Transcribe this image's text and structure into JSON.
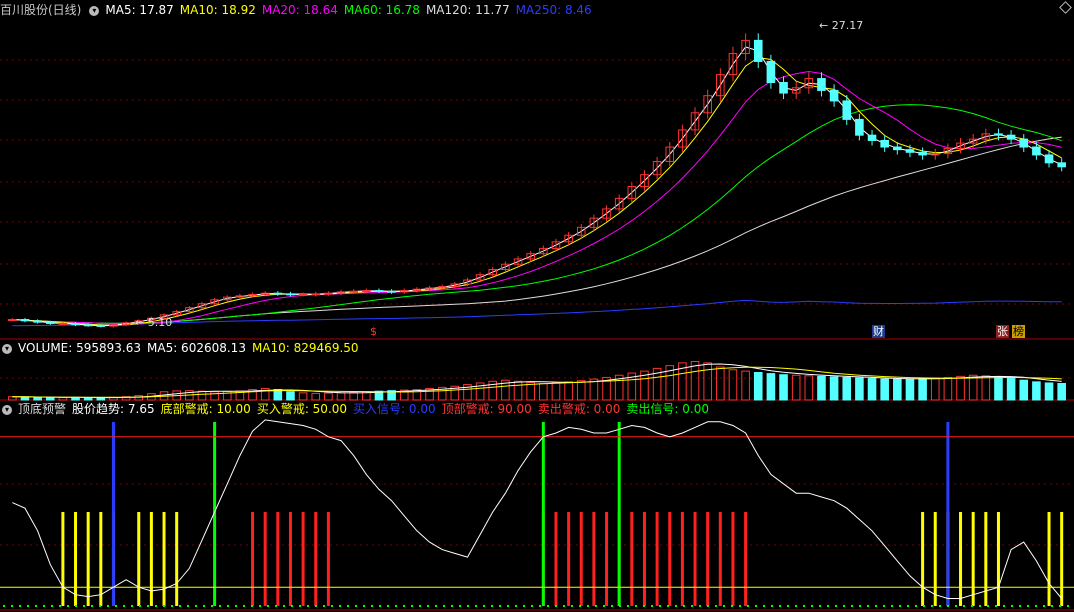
{
  "main_header": {
    "title": "百川股份(日线)",
    "ma5": "MA5: 17.87",
    "ma10": "MA10: 18.92",
    "ma20": "MA20: 18.64",
    "ma60": "MA60: 16.78",
    "ma120": "MA120: 11.77",
    "ma250": "MA250: 8.46"
  },
  "volume_header": {
    "volume": "VOLUME: 595893.63",
    "ma5": "MA5: 602608.13",
    "ma10": "MA10: 829469.50"
  },
  "indicator_header": {
    "name": "顶底预警",
    "trend": "股价趋势: 7.65",
    "bottom_warn": "底部警戒: 10.00",
    "buy_warn": "买入警戒: 50.00",
    "buy_signal": "买入信号: 0.00",
    "top_warn": "顶部警戒: 90.00",
    "sell_warn": "卖出警戒: 0.00",
    "sell_signal": "卖出信号: 0.00"
  },
  "annotations": {
    "high": "27.17",
    "low": "5.10",
    "marker_s": "$",
    "marker_cai": "财",
    "marker_zhang": "张",
    "marker_bang": "榜"
  },
  "colors": {
    "ma5": "#ffffff",
    "ma10": "#ffff00",
    "ma20": "#ff00ff",
    "ma60": "#00ff00",
    "ma120": "#dddddd",
    "ma250": "#2a3dff",
    "up": "#ff3232",
    "down": "#54ffff",
    "grid": "#7a0000"
  },
  "chart_data": {
    "type": "candlestick",
    "price_range": [
      4.5,
      28.5
    ],
    "closes": [
      5.6,
      5.5,
      5.4,
      5.3,
      5.3,
      5.2,
      5.15,
      5.1,
      5.2,
      5.35,
      5.5,
      5.7,
      5.95,
      6.2,
      6.5,
      6.8,
      7.1,
      7.3,
      7.4,
      7.5,
      7.6,
      7.55,
      7.5,
      7.5,
      7.55,
      7.6,
      7.7,
      7.75,
      7.8,
      7.75,
      7.7,
      7.8,
      7.9,
      8.0,
      8.1,
      8.3,
      8.6,
      9.0,
      9.4,
      9.8,
      10.2,
      10.6,
      11.0,
      11.5,
      12.0,
      12.6,
      13.3,
      14.0,
      14.8,
      15.7,
      16.6,
      17.6,
      18.7,
      20.0,
      21.3,
      22.6,
      24.2,
      25.8,
      26.8,
      25.2,
      23.6,
      22.8,
      23.2,
      23.9,
      23.0,
      22.2,
      20.8,
      19.6,
      19.2,
      18.7,
      18.5,
      18.3,
      18.1,
      18.2,
      18.6,
      19.0,
      19.3,
      19.7,
      19.6,
      19.3,
      18.7,
      18.1,
      17.5,
      17.2
    ],
    "volume_range": [
      0,
      1600000
    ],
    "volumes": [
      120000,
      110000,
      100000,
      95000,
      90000,
      90000,
      85000,
      85000,
      95000,
      120000,
      160000,
      230000,
      300000,
      330000,
      340000,
      320000,
      300000,
      310000,
      330000,
      380000,
      420000,
      380000,
      300000,
      260000,
      240000,
      250000,
      260000,
      280000,
      300000,
      320000,
      340000,
      360000,
      380000,
      420000,
      460000,
      500000,
      560000,
      620000,
      680000,
      720000,
      680000,
      640000,
      600000,
      620000,
      660000,
      700000,
      760000,
      820000,
      900000,
      980000,
      1050000,
      1150000,
      1250000,
      1350000,
      1400000,
      1350000,
      1200000,
      1100000,
      1050000,
      1000000,
      960000,
      920000,
      900000,
      880000,
      860000,
      840000,
      820000,
      800000,
      780000,
      760000,
      750000,
      760000,
      780000,
      800000,
      820000,
      860000,
      900000,
      880000,
      840000,
      780000,
      720000,
      660000,
      620000,
      600000
    ],
    "indicator_range": [
      0,
      100
    ],
    "indicator_values": [
      55,
      52,
      40,
      22,
      10,
      6,
      5,
      6,
      10,
      14,
      10,
      8,
      9,
      12,
      20,
      35,
      50,
      65,
      80,
      93,
      99,
      98,
      97,
      96,
      94,
      90,
      88,
      80,
      70,
      62,
      56,
      48,
      40,
      34,
      30,
      28,
      26,
      38,
      50,
      60,
      72,
      82,
      90,
      92,
      95,
      94,
      92,
      92,
      94,
      96,
      95,
      92,
      90,
      92,
      95,
      98,
      98,
      96,
      92,
      80,
      70,
      65,
      60,
      60,
      58,
      56,
      52,
      46,
      40,
      32,
      24,
      16,
      10,
      6,
      4,
      4,
      6,
      8,
      10,
      30,
      34,
      24,
      12,
      4
    ]
  }
}
